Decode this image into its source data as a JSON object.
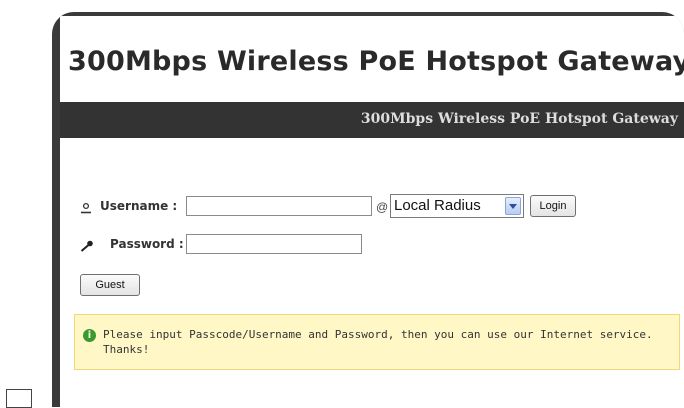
{
  "header": {
    "title": "300Mbps Wireless PoE Hotspot Gateway",
    "band_title": "300Mbps Wireless PoE Hotspot Gateway"
  },
  "login": {
    "username_label": "Username :",
    "username_value": "",
    "at_sign": "@",
    "realm_selected": "Local Radius",
    "login_button": "Login",
    "password_label": "Password :",
    "password_value": "",
    "guest_button": "Guest"
  },
  "notice": {
    "icon": "info-icon",
    "message": "Please input Passcode/Username and Password, then you can use our Internet service. Thanks!"
  },
  "icons": {
    "user": "user-icon",
    "key": "key-icon"
  },
  "colors": {
    "band": "#333333",
    "notice_bg": "#fff8c6",
    "notice_border": "#f2d77a",
    "info_icon": "#3b9a2d"
  }
}
